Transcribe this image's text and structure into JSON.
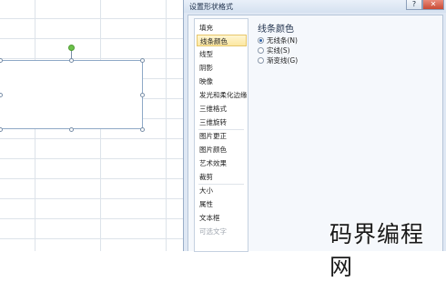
{
  "dialog": {
    "title": "设置形状格式",
    "help_icon": "?",
    "close_icon": "✕",
    "nav_items": [
      {
        "label": "填充",
        "selected": false,
        "disabled": false
      },
      {
        "label": "线条颜色",
        "selected": true,
        "disabled": false
      },
      {
        "label": "线型",
        "selected": false,
        "disabled": false
      },
      {
        "label": "阴影",
        "selected": false,
        "disabled": false
      },
      {
        "label": "映像",
        "selected": false,
        "disabled": false
      },
      {
        "label": "发光和柔化边缘",
        "selected": false,
        "disabled": false
      },
      {
        "label": "三维格式",
        "selected": false,
        "disabled": false
      },
      {
        "label": "三维旋转",
        "selected": false,
        "disabled": false
      },
      {
        "label": "图片更正",
        "selected": false,
        "disabled": false
      },
      {
        "label": "图片颜色",
        "selected": false,
        "disabled": false
      },
      {
        "label": "艺术效果",
        "selected": false,
        "disabled": false
      },
      {
        "label": "裁剪",
        "selected": false,
        "disabled": false
      },
      {
        "label": "大小",
        "selected": false,
        "disabled": false
      },
      {
        "label": "属性",
        "selected": false,
        "disabled": false
      },
      {
        "label": "文本框",
        "selected": false,
        "disabled": false
      },
      {
        "label": "可选文字",
        "selected": false,
        "disabled": true
      }
    ],
    "section_heading": "线条颜色",
    "options": [
      {
        "label": "无线条(N)",
        "checked": true
      },
      {
        "label": "实线(S)",
        "checked": false
      },
      {
        "label": "渐变线(G)",
        "checked": false
      }
    ]
  },
  "watermark": "码界编程网",
  "colors": {
    "selected_item_bg": "#fce7a2",
    "rotation_handle": "#6cc24a",
    "shape_border": "#8fa9c7"
  }
}
